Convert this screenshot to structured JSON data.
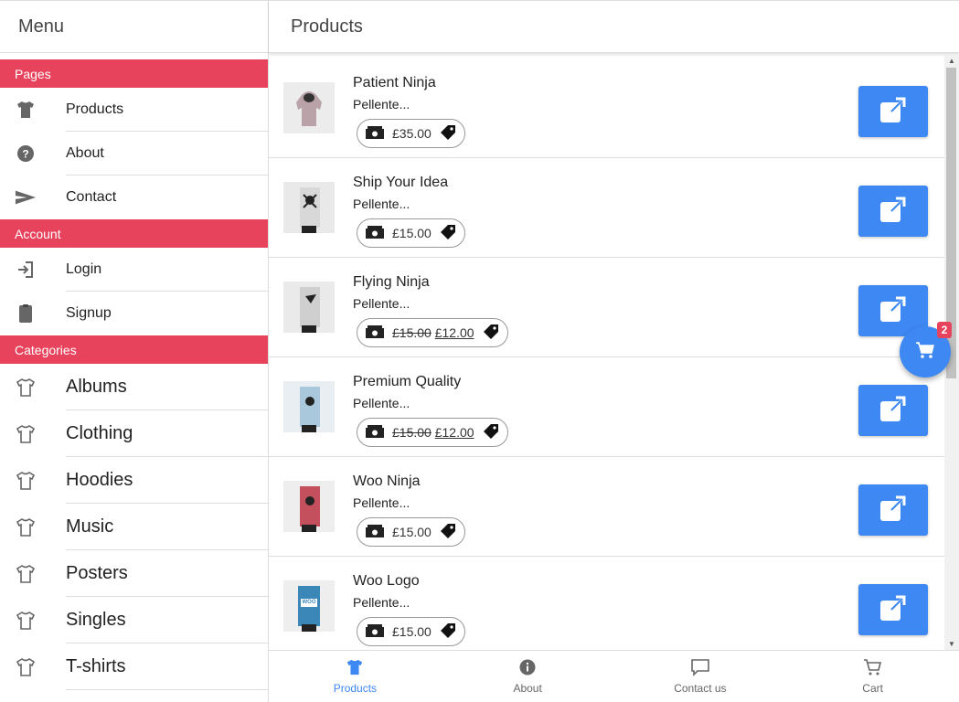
{
  "sidebar": {
    "title": "Menu",
    "sections": {
      "pages": "Pages",
      "account": "Account",
      "categories": "Categories"
    },
    "pages": [
      {
        "label": "Products",
        "icon": "tshirt-icon"
      },
      {
        "label": "About",
        "icon": "help-circle-icon"
      },
      {
        "label": "Contact",
        "icon": "send-icon"
      }
    ],
    "account": [
      {
        "label": "Login",
        "icon": "login-icon"
      },
      {
        "label": "Signup",
        "icon": "clipboard-icon"
      }
    ],
    "categories": [
      {
        "label": "Albums",
        "icon": "tshirt-outline-icon"
      },
      {
        "label": "Clothing",
        "icon": "tshirt-outline-icon"
      },
      {
        "label": "Hoodies",
        "icon": "tshirt-outline-icon"
      },
      {
        "label": "Music",
        "icon": "tshirt-outline-icon"
      },
      {
        "label": "Posters",
        "icon": "tshirt-outline-icon"
      },
      {
        "label": "Singles",
        "icon": "tshirt-outline-icon"
      },
      {
        "label": "T-shirts",
        "icon": "tshirt-outline-icon"
      }
    ]
  },
  "main": {
    "title": "Products",
    "products": [
      {
        "name": "Patient Ninja",
        "desc": "Pellente...",
        "price": "£35.00",
        "thumb_color": "#b9a3a8"
      },
      {
        "name": "Ship Your Idea",
        "desc": "Pellente...",
        "price": "£15.00",
        "thumb_color": "#d8d8d8"
      },
      {
        "name": "Flying Ninja",
        "desc": "Pellente...",
        "old_price": "£15.00",
        "price": "£12.00",
        "thumb_color": "#cfcfcf"
      },
      {
        "name": "Premium Quality",
        "desc": "Pellente...",
        "old_price": "£15.00",
        "price": "£12.00",
        "thumb_color": "#a9c8dc"
      },
      {
        "name": "Woo Ninja",
        "desc": "Pellente...",
        "price": "£15.00",
        "thumb_color": "#c4505e"
      },
      {
        "name": "Woo Logo",
        "desc": "Pellente...",
        "price": "£15.00",
        "thumb_color": "#3b87b8",
        "thumb_text": "WOO"
      }
    ]
  },
  "cart": {
    "badge": "2"
  },
  "tabs": [
    {
      "label": "Products",
      "icon": "tshirt-icon",
      "active": true
    },
    {
      "label": "About",
      "icon": "info-icon"
    },
    {
      "label": "Contact us",
      "icon": "chat-icon"
    },
    {
      "label": "Cart",
      "icon": "cart-icon"
    }
  ],
  "colors": {
    "accent": "#3d88f2",
    "section": "#e8435c"
  }
}
